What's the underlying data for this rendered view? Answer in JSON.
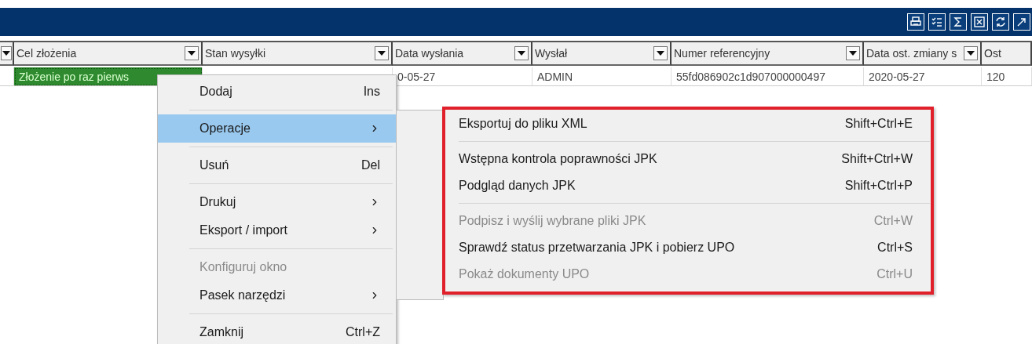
{
  "toolbar_buttons": [
    {
      "kind": "print"
    },
    {
      "kind": "checklist"
    },
    {
      "kind": "sigma"
    },
    {
      "kind": "clear"
    },
    {
      "kind": "refresh"
    },
    {
      "kind": "export"
    }
  ],
  "table": {
    "columns": [
      {
        "label": "Cel złożenia",
        "filter": true
      },
      {
        "label": "Stan wysyłki",
        "filter": true
      },
      {
        "label": "Data wysłania",
        "filter": true
      },
      {
        "label": "Wysłał",
        "filter": true
      },
      {
        "label": "Numer referencyjny",
        "filter": true
      },
      {
        "label": "Data ost. zmiany s",
        "filter": true
      },
      {
        "label": "Ost",
        "filter": false
      }
    ],
    "rows": [
      {
        "cells": [
          {
            "text": "Złożenie po raz pierws",
            "selected": true
          },
          {
            "selected": false
          },
          {
            "text": "0-05-27",
            "selected": false
          },
          {
            "text": "ADMIN",
            "selected": false
          },
          {
            "text": "55fd086902c1d907000000497",
            "selected": false
          },
          {
            "text": "2020-05-27",
            "selected": false
          },
          {
            "text": "120",
            "selected": false
          }
        ]
      }
    ]
  },
  "context_menu": {
    "items": [
      {
        "kind": "item",
        "label": "Dodaj",
        "shortcut": "Ins",
        "selected": false,
        "disabled": false,
        "has_submenu": false
      },
      {
        "kind": "separator"
      },
      {
        "kind": "item",
        "label": "Operacje",
        "selected": true,
        "disabled": false,
        "has_submenu": true
      },
      {
        "kind": "separator"
      },
      {
        "kind": "item",
        "label": "Usuń",
        "shortcut": "Del",
        "selected": false,
        "disabled": false,
        "has_submenu": false
      },
      {
        "kind": "separator"
      },
      {
        "kind": "item",
        "label": "Drukuj",
        "selected": false,
        "disabled": false,
        "has_submenu": true
      },
      {
        "kind": "item",
        "label": "Eksport / import",
        "selected": false,
        "disabled": false,
        "has_submenu": true
      },
      {
        "kind": "separator"
      },
      {
        "kind": "item",
        "label": "Konfiguruj okno",
        "selected": false,
        "disabled": true,
        "has_submenu": false
      },
      {
        "kind": "item",
        "label": "Pasek narzędzi",
        "selected": false,
        "disabled": false,
        "has_submenu": true
      },
      {
        "kind": "separator"
      },
      {
        "kind": "item",
        "label": "Zamknij",
        "shortcut": "Ctrl+Z",
        "selected": false,
        "disabled": false,
        "has_submenu": false
      }
    ]
  },
  "submenu": {
    "annotated": true,
    "items": [
      {
        "kind": "item",
        "label": "Eksportuj do pliku XML",
        "shortcut": "Shift+Ctrl+E",
        "disabled": false
      },
      {
        "kind": "separator"
      },
      {
        "kind": "item",
        "label": "Wstępna kontrola poprawności JPK",
        "shortcut": "Shift+Ctrl+W",
        "disabled": false
      },
      {
        "kind": "item",
        "label": "Podgląd danych JPK",
        "shortcut": "Shift+Ctrl+P",
        "disabled": false
      },
      {
        "kind": "separator"
      },
      {
        "kind": "item",
        "label": "Podpisz i wyślij wybrane pliki JPK",
        "shortcut": "Ctrl+W",
        "disabled": true
      },
      {
        "kind": "item",
        "label": "Sprawdź status przetwarzania JPK i pobierz UPO",
        "shortcut": "Ctrl+S",
        "disabled": false
      },
      {
        "kind": "item",
        "label": "Pokaż dokumenty UPO",
        "shortcut": "Ctrl+U",
        "disabled": true
      }
    ]
  }
}
